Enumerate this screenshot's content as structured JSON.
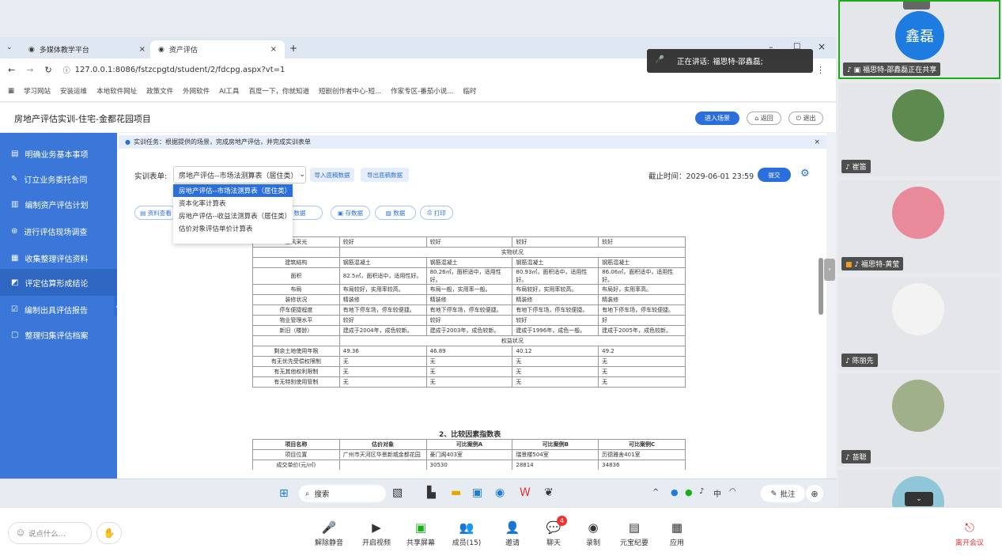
{
  "browser": {
    "tabs": [
      {
        "label": "多媒体教学平台"
      },
      {
        "label": "资产评估"
      }
    ],
    "url": "127.0.0.1:8086/fstzcpgtd/student/2/fdcpg.aspx?vt=1",
    "bookmarks": [
      "学习网站",
      "安装运维",
      "本地软件网址",
      "政策文件",
      "外网软件",
      "AI工具",
      "百度一下，你就知道",
      "短剧创作者中心-短...",
      "作家专区-番茄小说...",
      "临时"
    ]
  },
  "speaking": {
    "label": "正在讲话:",
    "name": "福思特-邵鑫磊;"
  },
  "app": {
    "title": "房地产评估实训-住宅-金都花园项目",
    "enter_scene": "进入场景",
    "back": "返回",
    "exit": "退出",
    "notice": "实训任务：根据提供的场景，完成房地产评估，并完成实训表单",
    "form_label": "实训表单:",
    "form_selected": "房地产评估--市场法测算表（居住类）",
    "import_btn": "导入底稿数据",
    "export_btn": "导出底稿数据",
    "deadline": "截止时间：2029-06-01 23:59",
    "submit": "提交",
    "toolbar": [
      "资料查看",
      "数据",
      "存数据",
      "数据",
      "打印"
    ],
    "dropdown": [
      "房地产评估--市场法测算表（居住类）",
      "资本化率计算表",
      "房地产评估--收益法测算表（居住类）",
      "估价对象评估单价计算表"
    ]
  },
  "sidebar": {
    "items": [
      {
        "label": "明确业务基本事项"
      },
      {
        "label": "订立业务委托合同"
      },
      {
        "label": "编制资产评估计划"
      },
      {
        "label": "进行评估现场调查"
      },
      {
        "label": "收集整理评估资料"
      },
      {
        "label": "评定估算形成结论"
      },
      {
        "label": "编制出具评估报告"
      },
      {
        "label": "整理归集评估档案"
      }
    ]
  },
  "table1": {
    "rows": [
      {
        "k": "通风采光",
        "v": [
          "较好",
          "较好",
          "较好",
          "较好"
        ]
      },
      {
        "section": "实物状况"
      },
      {
        "k": "建筑结构",
        "v": [
          "钢筋混凝土",
          "钢筋混凝土",
          "钢筋混凝土",
          "钢筋混凝土"
        ]
      },
      {
        "k": "面积",
        "v": [
          "82.5㎡，面积适中，适用性好。",
          "80.26㎡，面积适中，适用性好。",
          "80.93㎡，面积适中，适用性好。",
          "86.06㎡，面积适中，适用性好。"
        ]
      },
      {
        "k": "布局",
        "v": [
          "布局较好，实用率较高。",
          "布局一般，实用率一般。",
          "布局较好，实用率较高。",
          "布局好，实用率高。"
        ]
      },
      {
        "k": "装修状况",
        "v": [
          "精装修",
          "精装修",
          "精装修",
          "精装修"
        ]
      },
      {
        "k": "停车便捷程度",
        "v": [
          "有地下停车场，停车较便捷。",
          "有地下停车场，停车较便捷。",
          "有地下停车场，停车较便捷。",
          "有地下停车场，停车较便捷。"
        ]
      },
      {
        "k": "物业管理水平",
        "v": [
          "较好",
          "较好",
          "较好",
          "好"
        ]
      },
      {
        "k": "新旧（楼龄）",
        "v": [
          "建成于2004年，成色较新。",
          "建成于2003年，成色较新。",
          "建成于1996年，成色一般。",
          "建成于2005年，成色较新。"
        ]
      },
      {
        "section": "权益状况"
      },
      {
        "k": "剩余土地使用年限",
        "v": [
          "49.36",
          "46.89",
          "40.12",
          "49.2"
        ]
      },
      {
        "k": "有无优先受偿权限制",
        "v": [
          "无",
          "无",
          "无",
          "无"
        ]
      },
      {
        "k": "有无其他权利限制",
        "v": [
          "无",
          "无",
          "无",
          "无"
        ]
      },
      {
        "k": "有无特别使用管制",
        "v": [
          "无",
          "无",
          "无",
          "无"
        ]
      }
    ]
  },
  "table2": {
    "title": "2、比较因素指数表",
    "headers": [
      "项目名称",
      "估价对象",
      "可比案例A",
      "可比案例B",
      "可比案例C"
    ],
    "row1": [
      "项目位置",
      "广州市天河区华景新城金都花园",
      "豪门阁403室",
      "瑞景楼504室",
      "历德雅舍401室"
    ],
    "row2": [
      "成交单价(元/㎡)",
      "",
      "30530",
      "28814",
      "34836"
    ]
  },
  "taskbar": {
    "search": "搜索",
    "annot": "批注"
  },
  "meeting": {
    "self_name": "鑫磊",
    "share_label": "福思特-邵鑫磊正在共享",
    "participants": [
      "崔笛",
      "福思特-黄莹",
      "陈丽先",
      "苗聪"
    ],
    "say_placeholder": "说点什么...",
    "controls": [
      "解除静音",
      "开启视频",
      "共享屏幕",
      "成员(15)",
      "邀请",
      "聊天",
      "录制",
      "元宝纪要",
      "应用"
    ],
    "chat_badge": "4",
    "leave": "离开会议"
  }
}
